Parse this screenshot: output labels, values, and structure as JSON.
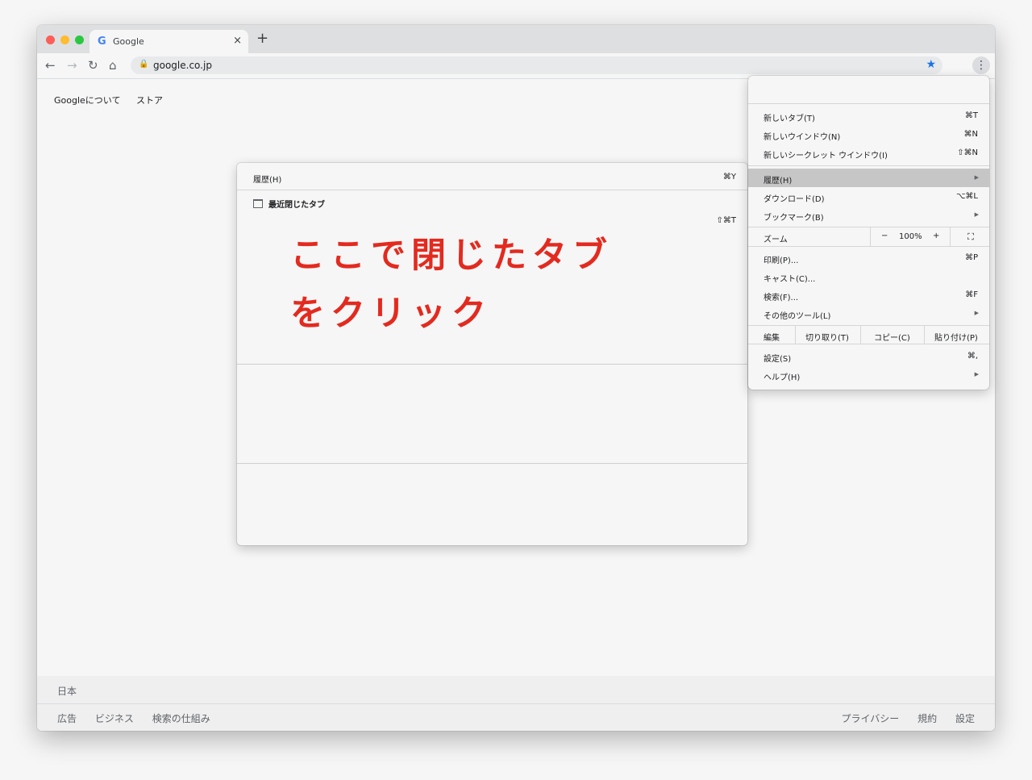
{
  "browser": {
    "tab_title": "Google",
    "url": "google.co.jp",
    "new_tab_symbol": "+",
    "close_symbol": "×"
  },
  "page": {
    "top_links": [
      "Googleについて",
      "ストア"
    ],
    "footer_country": "日本",
    "footer_left": [
      "広告",
      "ビジネス",
      "検索の仕組み"
    ],
    "footer_right": [
      "プライバシー",
      "規約",
      "設定"
    ]
  },
  "history_submenu": {
    "title": "履歴(H)",
    "title_shortcut": "⌘Y",
    "recently_closed_label": "最近閉じたタブ",
    "reopen_shortcut": "⇧⌘T"
  },
  "annotation": {
    "line1": "ここで閉じたタブ",
    "line2": "をクリック",
    "color": "#e32a1f"
  },
  "chrome_menu": {
    "items1": [
      {
        "label": "新しいタブ(T)",
        "shortcut": "⌘T"
      },
      {
        "label": "新しいウインドウ(N)",
        "shortcut": "⌘N"
      },
      {
        "label": "新しいシークレット ウインドウ(I)",
        "shortcut": "⇧⌘N"
      }
    ],
    "items2": [
      {
        "label": "履歴(H)",
        "shortcut": "▶"
      },
      {
        "label": "ダウンロード(D)",
        "shortcut": "⌥⌘L"
      },
      {
        "label": "ブックマーク(B)",
        "shortcut": "▶"
      }
    ],
    "zoom": {
      "label": "ズーム",
      "minus": "−",
      "value": "100%",
      "plus": "+",
      "fullscreen": "⛶"
    },
    "items3": [
      {
        "label": "印刷(P)...",
        "shortcut": "⌘P"
      },
      {
        "label": "キャスト(C)...",
        "shortcut": ""
      },
      {
        "label": "検索(F)...",
        "shortcut": "⌘F"
      },
      {
        "label": "その他のツール(L)",
        "shortcut": "▶"
      }
    ],
    "edit": {
      "label": "編集",
      "cut": "切り取り(T)",
      "copy": "コピー(C)",
      "paste": "貼り付け(P)"
    },
    "items4": [
      {
        "label": "設定(S)",
        "shortcut": "⌘,"
      },
      {
        "label": "ヘルプ(H)",
        "shortcut": "▶"
      }
    ]
  }
}
